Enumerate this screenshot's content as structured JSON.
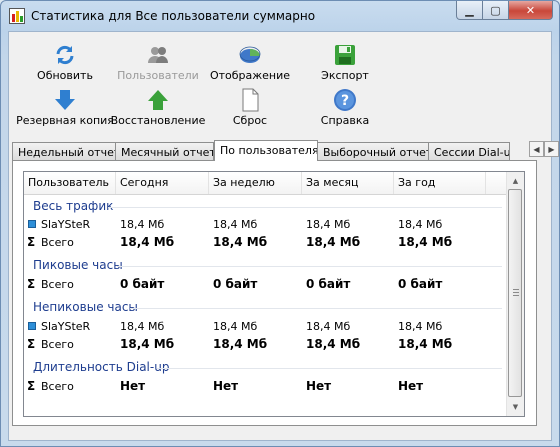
{
  "window": {
    "title": "Статистика для Все пользователи суммарно"
  },
  "toolbar": {
    "refresh": "Обновить",
    "users": "Пользователи",
    "display": "Отображение",
    "export": "Экспорт",
    "backup": "Резервная копия",
    "restore": "Восстановление",
    "reset": "Сброс",
    "help": "Справка"
  },
  "tabs": [
    "Недельный отчет",
    "Месячный отчет",
    "По пользователям",
    "Выборочный отчет",
    "Сессии Dial-up"
  ],
  "columns": [
    "Пользователь",
    "Сегодня",
    "За неделю",
    "За месяц",
    "За год"
  ],
  "groups": {
    "all": {
      "title": "Весь трафик",
      "user": {
        "name": "SlaYSteR",
        "values": [
          "18,4 Мб",
          "18,4 Мб",
          "18,4 Мб",
          "18,4 Мб"
        ]
      },
      "total": {
        "name": "Всего",
        "values": [
          "18,4 Мб",
          "18,4 Мб",
          "18,4 Мб",
          "18,4 Мб"
        ]
      }
    },
    "peak": {
      "title": "Пиковые часы",
      "total": {
        "name": "Всего",
        "values": [
          "0 байт",
          "0 байт",
          "0 байт",
          "0 байт"
        ]
      }
    },
    "offpeak": {
      "title": "Непиковые часы",
      "user": {
        "name": "SlaYSteR",
        "values": [
          "18,4 Мб",
          "18,4 Мб",
          "18,4 Мб",
          "18,4 Мб"
        ]
      },
      "total": {
        "name": "Всего",
        "values": [
          "18,4 Мб",
          "18,4 Мб",
          "18,4 Мб",
          "18,4 Мб"
        ]
      }
    },
    "dialup": {
      "title": "Длительность Dial-up",
      "total": {
        "name": "Всего",
        "values": [
          "Нет",
          "Нет",
          "Нет",
          "Нет"
        ]
      }
    }
  }
}
